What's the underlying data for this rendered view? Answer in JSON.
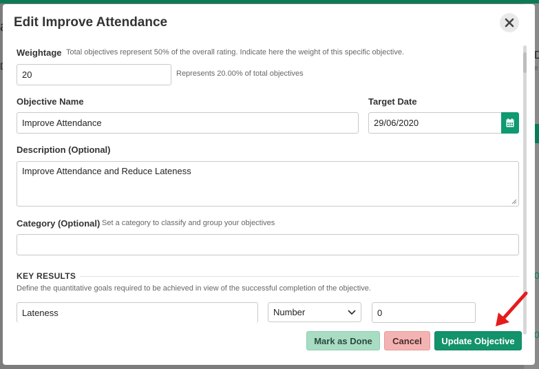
{
  "background": {
    "left_letter": "a",
    "left_letter2": "D",
    "right_letter": "D",
    "right_small": "e",
    "right_zero": "0",
    "right_zero2": "0"
  },
  "modal": {
    "title": "Edit Improve Attendance"
  },
  "weightage": {
    "label": "Weightage",
    "hint": "Total objectives represent 50% of the overall rating. Indicate here the weight of this specific objective.",
    "value": "20",
    "represents": "Represents 20.00% of total objectives"
  },
  "objective": {
    "name_label": "Objective Name",
    "name_value": "Improve Attendance",
    "target_label": "Target Date",
    "target_value": "29/06/2020"
  },
  "description": {
    "label": "Description (Optional)",
    "value": "Improve Attendance and Reduce Lateness"
  },
  "category": {
    "label": "Category (Optional)",
    "hint": "Set a category to classify and group your objectives",
    "value": ""
  },
  "key_results": {
    "heading": "KEY RESULTS",
    "hint": "Define the quantitative goals required to be achieved in view of the successful completion of the objective.",
    "items": [
      {
        "name": "Lateness",
        "type": "Number",
        "value": "0"
      }
    ]
  },
  "footer": {
    "mark_done_label": "Mark as Done",
    "cancel_label": "Cancel",
    "update_label": "Update Objective"
  },
  "colors": {
    "accent": "#13936b",
    "cancel": "#f4b3b3",
    "mark_done": "#a8ddc4",
    "annotation_arrow": "#e51c1c"
  }
}
